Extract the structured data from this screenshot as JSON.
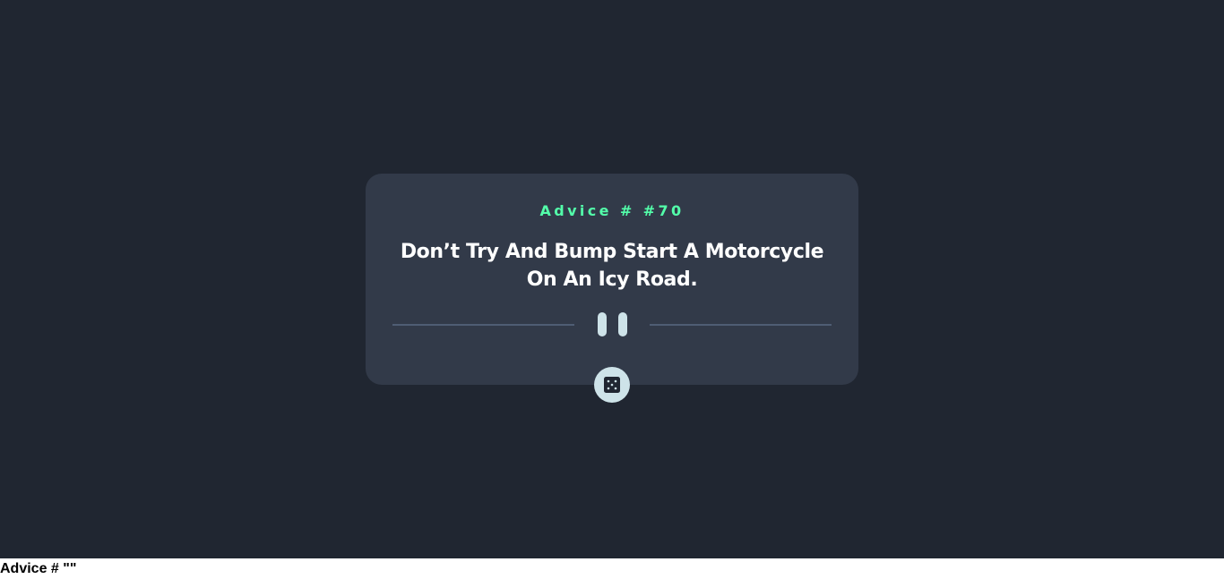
{
  "card": {
    "advice_id": "Advice # #70",
    "advice_text": "Don’t Try And Bump Start A Motorcycle On An Icy Road."
  },
  "icons": {
    "divider": "pause-icon",
    "generate_button": "dice-icon"
  },
  "footer": {
    "text": "Advice # \"\""
  },
  "colors": {
    "page_background": "#202631",
    "card_background": "#323a49",
    "accent_green": "#53ffaa",
    "divider": "#4f5d74",
    "light_cyan": "#cee3e9",
    "text_white": "#ffffff"
  }
}
